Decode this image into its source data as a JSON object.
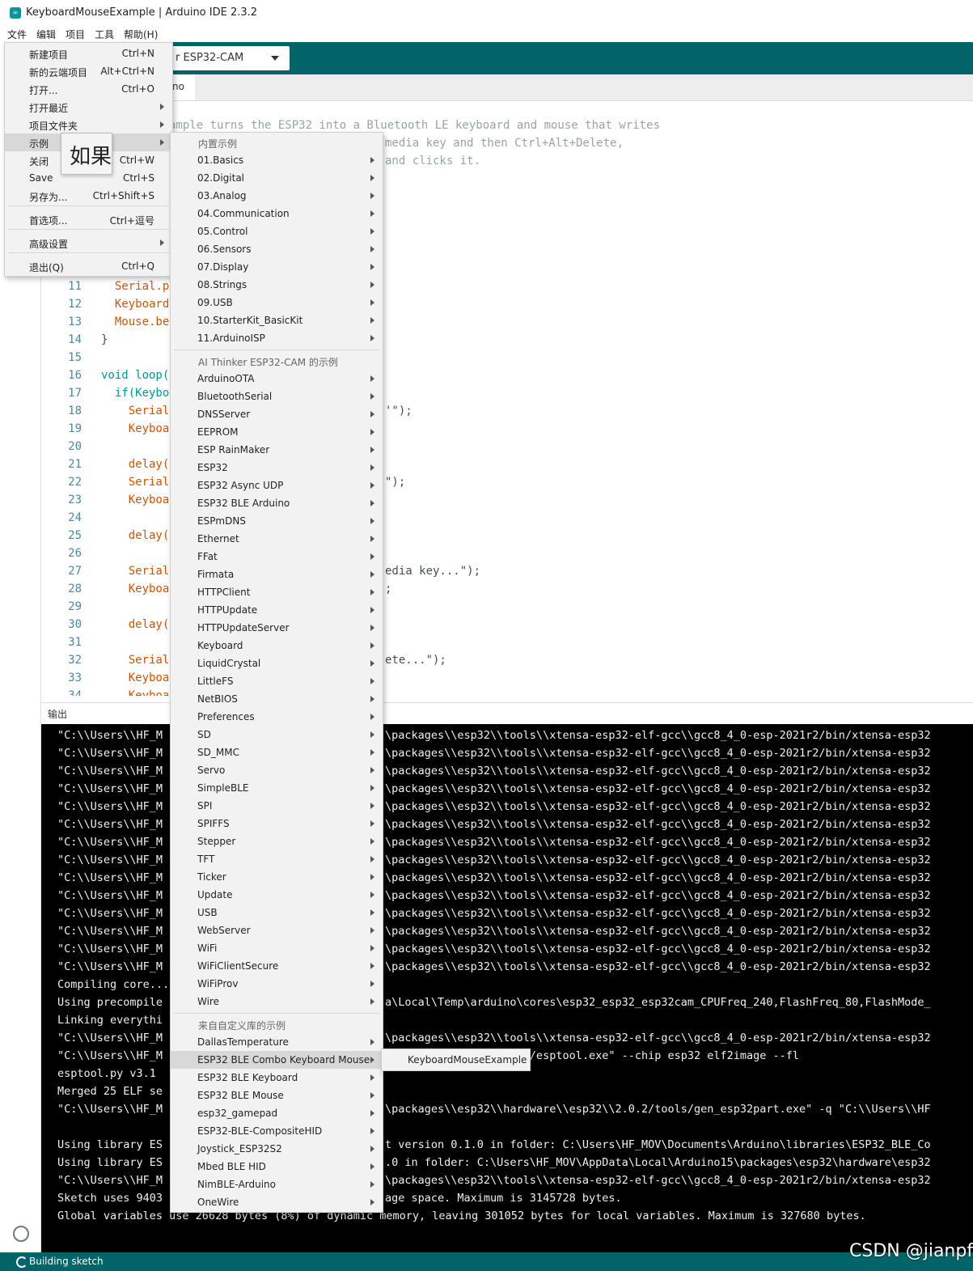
{
  "window": {
    "title": "KeyboardMouseExample | Arduino IDE 2.3.2"
  },
  "menubar": [
    "文件",
    "编辑",
    "项目",
    "工具",
    "帮助(H)"
  ],
  "toolbar": {
    "board": "r ESP32-CAM"
  },
  "tab": {
    "label": "no"
  },
  "editor": {
    "comment_lines": [
      "ample turns the ESP32 into a Bluetooth LE keyboard and mouse that writes",
      "media key and then Ctrl+Alt+Delete,",
      "and clicks it."
    ],
    "lines": [
      {
        "n": "11",
        "t": "  Serial.p"
      },
      {
        "n": "12",
        "t": "  Keyboard"
      },
      {
        "n": "13",
        "t": "  Mouse.be"
      },
      {
        "n": "14",
        "t": "}"
      },
      {
        "n": "15",
        "t": ""
      },
      {
        "n": "16",
        "t": "void loop("
      },
      {
        "n": "17",
        "t": "  if(Keybo"
      },
      {
        "n": "18",
        "t": "    Serial"
      },
      {
        "n": "19",
        "t": "    Keyboa"
      },
      {
        "n": "20",
        "t": ""
      },
      {
        "n": "21",
        "t": "    delay("
      },
      {
        "n": "22",
        "t": "    Serial"
      },
      {
        "n": "23",
        "t": "    Keyboa"
      },
      {
        "n": "24",
        "t": ""
      },
      {
        "n": "25",
        "t": "    delay("
      },
      {
        "n": "26",
        "t": ""
      },
      {
        "n": "27",
        "t": "    Serial"
      },
      {
        "n": "28",
        "t": "    Keyboa"
      },
      {
        "n": "29",
        "t": ""
      },
      {
        "n": "30",
        "t": "    delay("
      },
      {
        "n": "31",
        "t": ""
      },
      {
        "n": "32",
        "t": "    Serial"
      },
      {
        "n": "33",
        "t": "    Keyboa"
      },
      {
        "n": "34",
        "t": "    Keyboa"
      }
    ],
    "right_fragments": [
      {
        "line": "18",
        "t": "'\");"
      },
      {
        "line": "22",
        "t": "\");"
      },
      {
        "line": "27",
        "t": "edia key...\");"
      },
      {
        "line": "28",
        "t": ";"
      },
      {
        "line": "32",
        "t": "ete...\");"
      }
    ]
  },
  "output": {
    "title": "输出",
    "left_lines": [
      "\"C:\\\\Users\\\\HF_M",
      "\"C:\\\\Users\\\\HF_M",
      "\"C:\\\\Users\\\\HF_M",
      "\"C:\\\\Users\\\\HF_M",
      "\"C:\\\\Users\\\\HF_M",
      "\"C:\\\\Users\\\\HF_M",
      "\"C:\\\\Users\\\\HF_M",
      "\"C:\\\\Users\\\\HF_M",
      "\"C:\\\\Users\\\\HF_M",
      "\"C:\\\\Users\\\\HF_M",
      "\"C:\\\\Users\\\\HF_M",
      "\"C:\\\\Users\\\\HF_M",
      "\"C:\\\\Users\\\\HF_M",
      "\"C:\\\\Users\\\\HF_M",
      "Compiling core...",
      "Using precompile",
      "Linking everythi",
      "\"C:\\\\Users\\\\HF_M",
      "\"C:\\\\Users\\\\HF_M",
      "esptool.py v3.1",
      "Merged 25 ELF se",
      "\"C:\\\\Users\\\\HF_M",
      "",
      "Using library ES",
      "Using library ES",
      "\"C:\\\\Users\\\\HF_M",
      "Sketch uses 9403",
      "Global variables use 26628 bytes (8%) of dynamic memory, leaving 301052 bytes for local variables. Maximum is 327680 bytes."
    ],
    "right_lines": [
      "\\packages\\\\esp32\\\\tools\\\\xtensa-esp32-elf-gcc\\\\gcc8_4_0-esp-2021r2/bin/xtensa-esp32",
      "\\packages\\\\esp32\\\\tools\\\\xtensa-esp32-elf-gcc\\\\gcc8_4_0-esp-2021r2/bin/xtensa-esp32",
      "\\packages\\\\esp32\\\\tools\\\\xtensa-esp32-elf-gcc\\\\gcc8_4_0-esp-2021r2/bin/xtensa-esp32",
      "\\packages\\\\esp32\\\\tools\\\\xtensa-esp32-elf-gcc\\\\gcc8_4_0-esp-2021r2/bin/xtensa-esp32",
      "\\packages\\\\esp32\\\\tools\\\\xtensa-esp32-elf-gcc\\\\gcc8_4_0-esp-2021r2/bin/xtensa-esp32",
      "\\packages\\\\esp32\\\\tools\\\\xtensa-esp32-elf-gcc\\\\gcc8_4_0-esp-2021r2/bin/xtensa-esp32",
      "\\packages\\\\esp32\\\\tools\\\\xtensa-esp32-elf-gcc\\\\gcc8_4_0-esp-2021r2/bin/xtensa-esp32",
      "\\packages\\\\esp32\\\\tools\\\\xtensa-esp32-elf-gcc\\\\gcc8_4_0-esp-2021r2/bin/xtensa-esp32",
      "\\packages\\\\esp32\\\\tools\\\\xtensa-esp32-elf-gcc\\\\gcc8_4_0-esp-2021r2/bin/xtensa-esp32",
      "\\packages\\\\esp32\\\\tools\\\\xtensa-esp32-elf-gcc\\\\gcc8_4_0-esp-2021r2/bin/xtensa-esp32",
      "\\packages\\\\esp32\\\\tools\\\\xtensa-esp32-elf-gcc\\\\gcc8_4_0-esp-2021r2/bin/xtensa-esp32",
      "\\packages\\\\esp32\\\\tools\\\\xtensa-esp32-elf-gcc\\\\gcc8_4_0-esp-2021r2/bin/xtensa-esp32",
      "\\packages\\\\esp32\\\\tools\\\\xtensa-esp32-elf-gcc\\\\gcc8_4_0-esp-2021r2/bin/xtensa-esp32",
      "\\packages\\\\esp32\\\\tools\\\\xtensa-esp32-elf-gcc\\\\gcc8_4_0-esp-2021r2/bin/xtensa-esp32",
      "",
      "a\\Local\\Temp\\arduino\\cores\\esp32_esp32_esp32cam_CPUFreq_240,FlashFreq_80,FlashMode_",
      "",
      "\\packages\\\\esp32\\\\tools\\\\xtensa-esp32-elf-gcc\\\\gcc8_4_0-esp-2021r2/bin/xtensa-esp32",
      "ols\\\\esptool_py\\\\3.1.0/esptool.exe\" --chip esp32 elf2image --fl",
      "",
      "",
      "\\packages\\\\esp32\\\\hardware\\\\esp32\\\\2.0.2/tools/gen_esp32part.exe\" -q \"C:\\\\Users\\\\HF",
      "",
      "t version 0.1.0 in folder: C:\\Users\\HF_MOV\\Documents\\Arduino\\libraries\\ESP32_BLE_Co",
      ".0 in folder: C:\\Users\\HF_MOV\\AppData\\Local\\Arduino15\\packages\\esp32\\hardware\\esp32",
      "\\packages\\\\esp32\\\\tools\\\\xtensa-esp32-elf-gcc\\\\gcc8_4_0-esp-2021r2/bin/xtensa-esp32",
      "age space. Maximum is 3145728 bytes.",
      ""
    ]
  },
  "file_menu": [
    {
      "label": "新建项目",
      "shortcut": "Ctrl+N"
    },
    {
      "label": "新的云端项目",
      "shortcut": "Alt+Ctrl+N"
    },
    {
      "label": "打开...",
      "shortcut": "Ctrl+O"
    },
    {
      "label": "打开最近",
      "shortcut": "",
      "submenu": true
    },
    {
      "label": "项目文件夹",
      "shortcut": "",
      "submenu": true
    },
    {
      "label": "示例",
      "shortcut": "",
      "submenu": true,
      "highlight": true
    },
    {
      "label": "关闭",
      "shortcut": "Ctrl+W"
    },
    {
      "label": "Save",
      "shortcut": "Ctrl+S"
    },
    {
      "label": "另存为...",
      "shortcut": "Ctrl+Shift+S"
    },
    {
      "label": "首选项...",
      "shortcut": "Ctrl+逗号"
    },
    {
      "label": "高级设置",
      "shortcut": "",
      "submenu": true
    },
    {
      "label": "退出(Q)",
      "shortcut": "Ctrl+Q"
    }
  ],
  "tooltip": {
    "text": "如果"
  },
  "examples_menu": {
    "header_builtin": "内置示例",
    "builtin": [
      "01.Basics",
      "02.Digital",
      "03.Analog",
      "04.Communication",
      "05.Control",
      "06.Sensors",
      "07.Display",
      "08.Strings",
      "09.USB",
      "10.StarterKit_BasicKit",
      "11.ArduinoISP"
    ],
    "header_board": "AI Thinker ESP32-CAM 的示例",
    "board": [
      "ArduinoOTA",
      "BluetoothSerial",
      "DNSServer",
      "EEPROM",
      "ESP RainMaker",
      "ESP32",
      "ESP32 Async UDP",
      "ESP32 BLE Arduino",
      "ESPmDNS",
      "Ethernet",
      "FFat",
      "Firmata",
      "HTTPClient",
      "HTTPUpdate",
      "HTTPUpdateServer",
      "Keyboard",
      "LiquidCrystal",
      "LittleFS",
      "NetBIOS",
      "Preferences",
      "SD",
      "SD_MMC",
      "Servo",
      "SimpleBLE",
      "SPI",
      "SPIFFS",
      "Stepper",
      "TFT",
      "Ticker",
      "Update",
      "USB",
      "WebServer",
      "WiFi",
      "WiFiClientSecure",
      "WiFiProv",
      "Wire"
    ],
    "header_custom": "来自自定义库的示例",
    "custom": [
      "DallasTemperature",
      "ESP32 BLE Combo Keyboard Mouse",
      "ESP32 BLE Keyboard",
      "ESP32 BLE Mouse",
      "esp32_gamepad",
      "ESP32-BLE-CompositeHID",
      "Joystick_ESP32S2",
      "Mbed BLE HID",
      "NimBLE-Arduino",
      "OneWire"
    ]
  },
  "submenu_example": {
    "label": "KeyboardMouseExample"
  },
  "statusbar": {
    "text": "Building sketch"
  },
  "watermark": {
    "text": "CSDN @jianpf"
  }
}
